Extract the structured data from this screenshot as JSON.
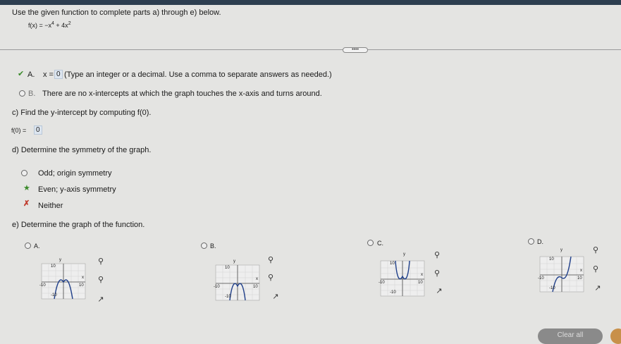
{
  "instructions": "Use the given function to complete parts a) through e) below.",
  "function": {
    "prefix": "f(x) = −x",
    "exp1": "4",
    "mid": " + 4x",
    "exp2": "2"
  },
  "divider_handle": "••••",
  "partA": {
    "optionA_letter": "A.",
    "x_label": "x =",
    "x_value": "0",
    "x_hint": "(Type an integer or a decimal. Use a comma to separate answers as needed.)",
    "optionB_letter": "B.",
    "optionB_text": "There are no x-intercepts at which the graph touches the x-axis and turns around."
  },
  "partC": {
    "prompt": "c) Find the y-intercept by computing f(0).",
    "label": "f(0) =",
    "value": "0"
  },
  "partD": {
    "prompt": "d) Determine the symmetry of the graph.",
    "options": [
      "Odd; origin symmetry",
      "Even; y-axis symmetry",
      "Neither"
    ]
  },
  "partE": {
    "prompt": "e) Determine the graph of the function.",
    "choices": [
      "A.",
      "B.",
      "C.",
      "D."
    ],
    "axis": {
      "y": "y",
      "x": "x",
      "top": "10",
      "bottom": "-10",
      "left": "-10",
      "right": "10"
    }
  },
  "clear_all": "Clear all",
  "colors": {
    "correct": "#3a8a2a",
    "incorrect": "#c0392b",
    "answer_box": "#dde6f0"
  }
}
